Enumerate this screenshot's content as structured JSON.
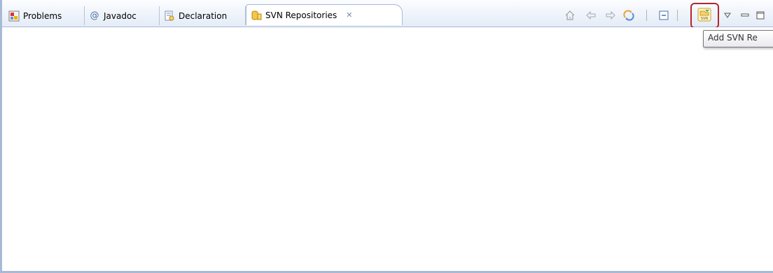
{
  "tabs": [
    {
      "label": "Problems",
      "icon": "problems-icon"
    },
    {
      "label": "Javadoc",
      "icon": "javadoc-at-icon"
    },
    {
      "label": "Declaration",
      "icon": "declaration-icon"
    },
    {
      "label": "SVN Repositories",
      "icon": "svn-repositories-icon",
      "active": true
    }
  ],
  "javadoc_glyph": "@",
  "close_glyph": "✕",
  "toolbar": {
    "buttons": [
      "home-icon",
      "back-arrow-icon",
      "forward-arrow-icon",
      "refresh-icon",
      "collapse-all-icon",
      "add-svn-repository-icon",
      "view-menu-icon",
      "minimize-icon",
      "maximize-icon"
    ],
    "svn_icon_text": "SVN"
  },
  "tooltip": {
    "text": "Add SVN Re"
  },
  "colors": {
    "border": "#a8b9d6",
    "highlight": "#b5242f",
    "tab_bar": "#e4ecf7"
  }
}
